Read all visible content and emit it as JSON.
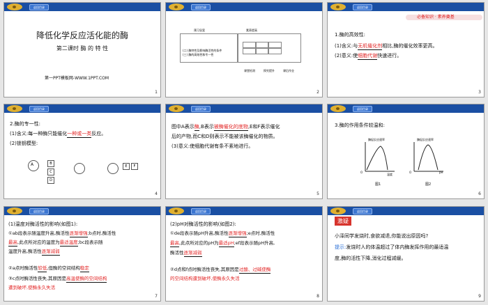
{
  "header_badge": "返回目录",
  "slides": [
    {
      "num": "1",
      "title": "降低化学反应活化能的酶",
      "subtitle": "第二课时  酶 的 特 性",
      "footer": "第一PPT模板网-WWW.1PPT.COM"
    },
    {
      "num": "2",
      "col1": "预习导案",
      "col2": "素养提高",
      "sample1": "(二) 酶特性及影响酶活性的条件",
      "sample2": "(三) 酶的高效性和专一性",
      "axis1": "课堂检测",
      "axis2": "探究提升",
      "axis3": "课后作业"
    },
    {
      "num": "3",
      "banner": "必备知识 · 素养奠基",
      "h": "1.酶的高效性:",
      "l1_pre": "(1)含义:与",
      "l1_fill": "无机催化剂",
      "l1_post": "相比,酶的催化效率更高。",
      "l2_pre": "(2)意义:使",
      "l2_fill": "细胞代谢",
      "l2_post": "快速进行。"
    },
    {
      "num": "4",
      "h": "2.酶的专一性:",
      "l1_pre": "(1)含义:每一种酶只能催化",
      "l1_fill": "一种或一类",
      "l1_post": "反应。",
      "l2": "(2)锁钥模型:",
      "a": "A",
      "b": "B",
      "c": "C",
      "d": "D",
      "e": "E",
      "f": "F"
    },
    {
      "num": "5",
      "l1_pre": "图中A表示",
      "l1_fill1": "酶",
      "l1_mid": ",B表示",
      "l1_fill2": "被酶催化的底物",
      "l1_post": ",E和F表示催化",
      "l2": "后的产物,而C和D则表示不能被该酶催化的物质。",
      "l3": "(3)意义:使细胞代谢有条不紊地进行。"
    },
    {
      "num": "6",
      "h": "3.酶的作用条件较温和:",
      "ylab": "酶促反应速率",
      "x1": "温度",
      "x2": "pH",
      "o": "O",
      "p1": "图1",
      "p2": "图2"
    },
    {
      "num": "7",
      "h": "(1)温度对酶活性的影响(如图1):",
      "l1_pre": "①ab段表示随温度升高,酶活性",
      "l1_fill": "逐渐增强",
      "l1_post": ";b点时,酶活性",
      "l2_fill": "最高",
      "l2_mid": ",此点所对应的温度为",
      "l2_fill2": "最适温度",
      "l2_post": ";bc段表示随",
      "l3_pre": "温度升高,酶活性",
      "l3_fill": "逐渐减弱",
      "l4_pre": "②a点时酶活性",
      "l4_fill": "较低",
      "l4_mid": ",但酶的空间结构",
      "l4_fill2": "稳定",
      "l5_pre": "③c点时酶活性丧失,其原因是",
      "l5_fill": "高温使酶的空间结构",
      "l6_fill": "遭到破坏,使酶永久失活"
    },
    {
      "num": "8",
      "h": "(2)pH对酶活性的影响(如图2):",
      "l1_pre": "①de段表示随pH升高,酶活性",
      "l1_fill": "逐渐增强",
      "l1_post": ";e点时,酶活性",
      "l2_fill": "最高",
      "l2_mid": ",此点所对应的pH为",
      "l2_fill2": "最适pH",
      "l2_post": ";ef段表示随pH升高,",
      "l3_pre": "酶活性",
      "l3_fill": "逐渐减弱",
      "l4_pre": "②d点和f点时酶活性丧失,其原因是",
      "l4_fill": "过酸、过碱使酶",
      "l5_fill": "的空间结构遭到破坏,使酶永久失活"
    },
    {
      "num": "9",
      "tag": "激疑",
      "q": "小泽同学发烧时,食欲减退,你能说出原因吗?",
      "a_pre": "提示:",
      "a1": "发烧时人的体温超过了体内酶发挥作用的最适温",
      "a2": "度,酶的活性下降,消化过程减缓。"
    }
  ]
}
